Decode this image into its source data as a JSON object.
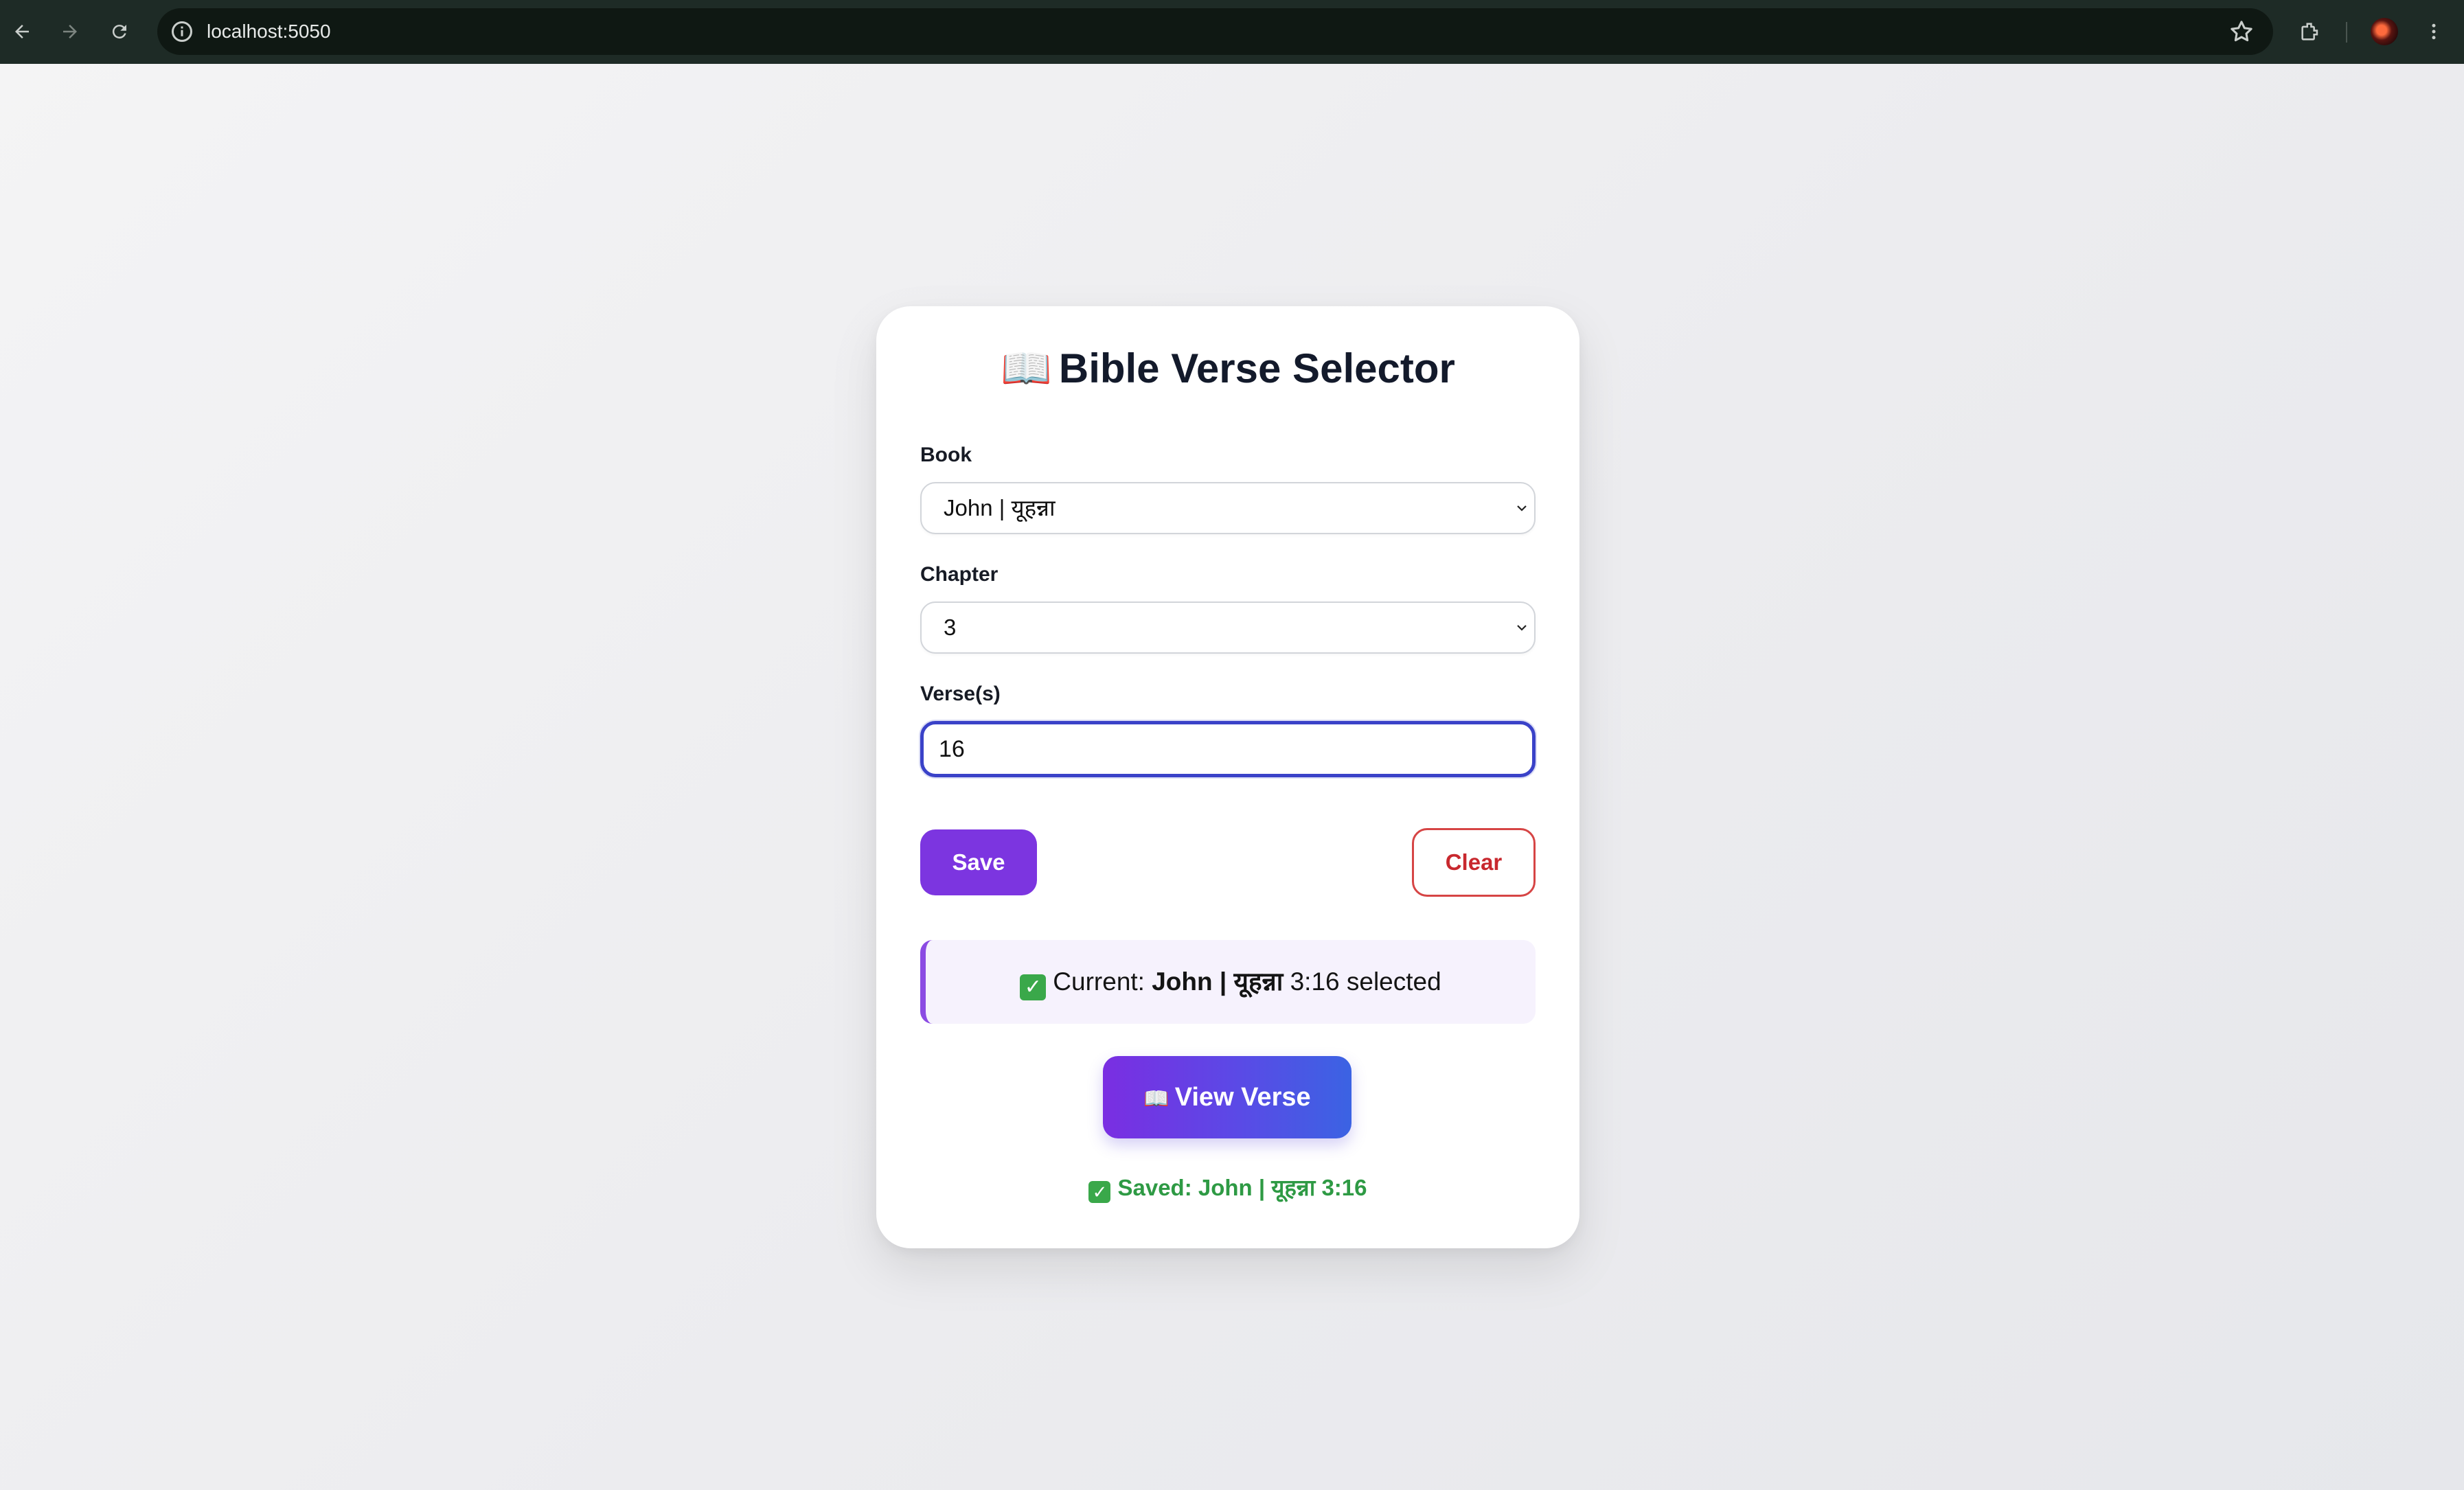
{
  "browser": {
    "url": "localhost:5050",
    "icons": [
      "back-icon",
      "forward-icon",
      "reload-icon",
      "site-info-icon",
      "bookmark-star-icon",
      "extensions-icon",
      "profile-avatar",
      "menu-kebab-icon"
    ]
  },
  "app": {
    "title": "Bible Verse Selector",
    "title_emoji": "📖",
    "book_label": "Book",
    "book_value": "John | यूहन्ना",
    "chapter_label": "Chapter",
    "chapter_value": "3",
    "verse_label": "Verse(s)",
    "verse_value": "16",
    "save_label": "Save",
    "clear_label": "Clear",
    "current_check": "✓",
    "current_prefix": "Current:",
    "current_book": "John | यूहन्ना",
    "current_ref": "3:16 selected",
    "view_emoji": "📖",
    "view_label": "View Verse",
    "saved_text": "Saved: John | यूहन्ना 3:16"
  },
  "colors": {
    "accent_purple": "#7c35e0",
    "view_gradient_end": "#3b63e3",
    "clear_red": "#c8282e",
    "saved_green": "#2e9a44",
    "focus_blue": "#3a42c8"
  }
}
